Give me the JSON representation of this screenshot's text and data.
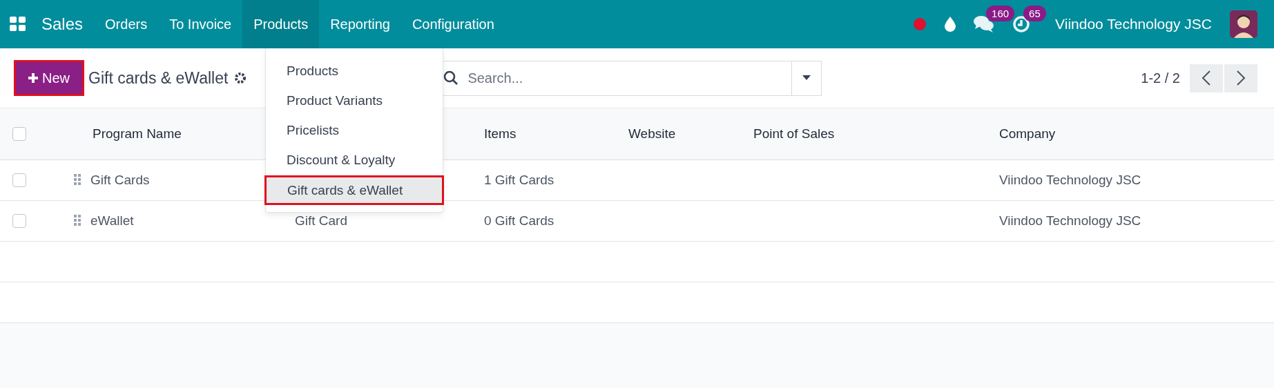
{
  "navbar": {
    "app_name": "Sales",
    "menu": [
      {
        "label": "Orders",
        "selected": false
      },
      {
        "label": "To Invoice",
        "selected": false
      },
      {
        "label": "Products",
        "selected": true
      },
      {
        "label": "Reporting",
        "selected": false
      },
      {
        "label": "Configuration",
        "selected": false
      }
    ],
    "messages_badge": "160",
    "activities_badge": "65",
    "company": "Viindoo Technology JSC"
  },
  "control_panel": {
    "new_button": {
      "label": "New",
      "highlighted": true
    },
    "title": "Gift cards & eWallet",
    "search": {
      "placeholder": "Search..."
    },
    "pager": "1-2 / 2"
  },
  "dropdown": {
    "items": [
      {
        "label": "Products",
        "selected": false,
        "highlighted": false
      },
      {
        "label": "Product Variants",
        "selected": false,
        "highlighted": false
      },
      {
        "label": "Pricelists",
        "selected": false,
        "highlighted": false
      },
      {
        "label": "Discount & Loyalty",
        "selected": false,
        "highlighted": false
      },
      {
        "label": "Gift cards & eWallet",
        "selected": true,
        "highlighted": true
      }
    ]
  },
  "table": {
    "columns": [
      "Program Name",
      null,
      "Items",
      "Website",
      "Point of Sales",
      "Company"
    ],
    "rows": [
      {
        "checked": false,
        "cells": [
          "Gift Cards",
          null,
          "1 Gift Cards",
          null,
          null,
          "Viindoo Technology JSC"
        ]
      },
      {
        "checked": false,
        "cells": [
          "eWallet",
          "Gift Card",
          "0 Gift Cards",
          null,
          null,
          "Viindoo Technology JSC"
        ]
      }
    ],
    "all_checked": false
  }
}
